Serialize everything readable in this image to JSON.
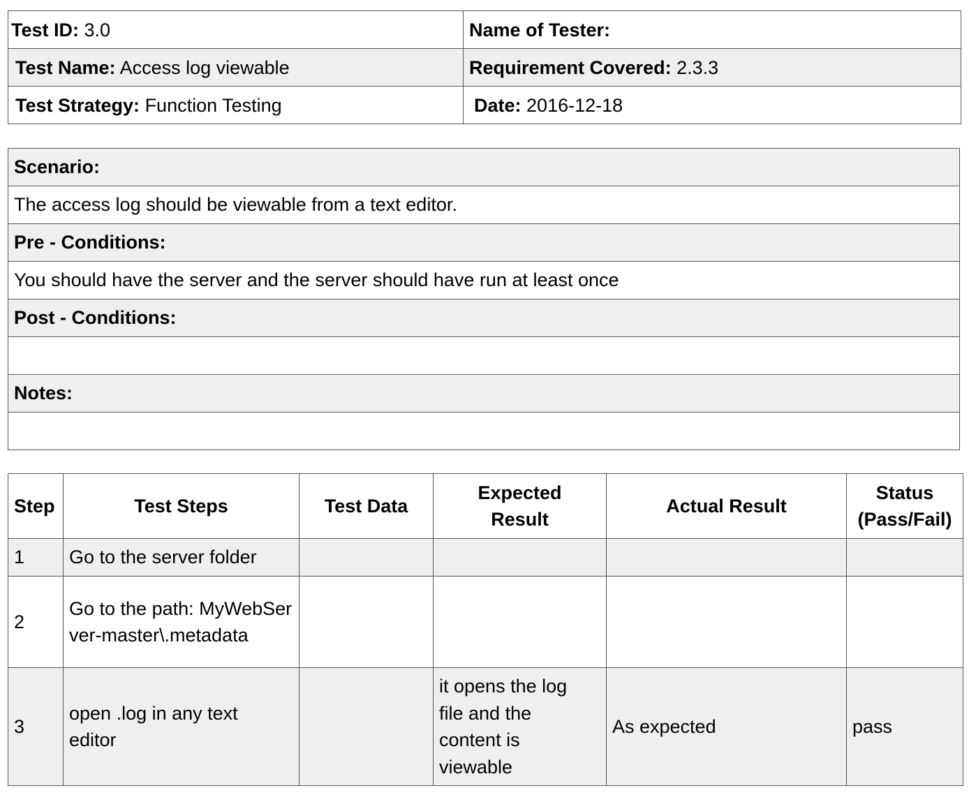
{
  "header": {
    "test_id_label": "Test ID:",
    "test_id": "3.0",
    "tester_label": "Name of Tester:",
    "tester": "",
    "test_name_label": "Test Name:",
    "test_name": "Access log viewable",
    "requirement_label": "Requirement Covered:",
    "requirement": "2.3.3",
    "strategy_label": "Test Strategy:",
    "strategy": "Function Testing",
    "date_label": "Date:",
    "date": "2016-12-18"
  },
  "sections": {
    "scenario_label": "Scenario:",
    "scenario": "The access log should be viewable from a text editor.",
    "pre_label": "Pre - Conditions:",
    "pre": "You should have the server and the server should have run at least once",
    "post_label": "Post - Conditions:",
    "post": "",
    "notes_label": "Notes:",
    "notes": ""
  },
  "steps_table": {
    "headers": [
      "Step",
      "Test Steps",
      "Test Data",
      "Expected Result",
      "Actual Result",
      "Status (Pass/Fail)"
    ],
    "rows": [
      {
        "step": "1",
        "test_steps": "Go to the server folder",
        "test_data": "",
        "expected": "",
        "actual": "",
        "status": ""
      },
      {
        "step": "2",
        "test_steps": "Go to the path: MyWebServer-master\\.metadata",
        "test_data": "",
        "expected": "",
        "actual": "",
        "status": ""
      },
      {
        "step": "3",
        "test_steps": "open .log in any text editor",
        "test_data": "",
        "expected": "it opens the log file and the content is viewable",
        "actual": "As expected",
        "status": "pass"
      }
    ]
  }
}
